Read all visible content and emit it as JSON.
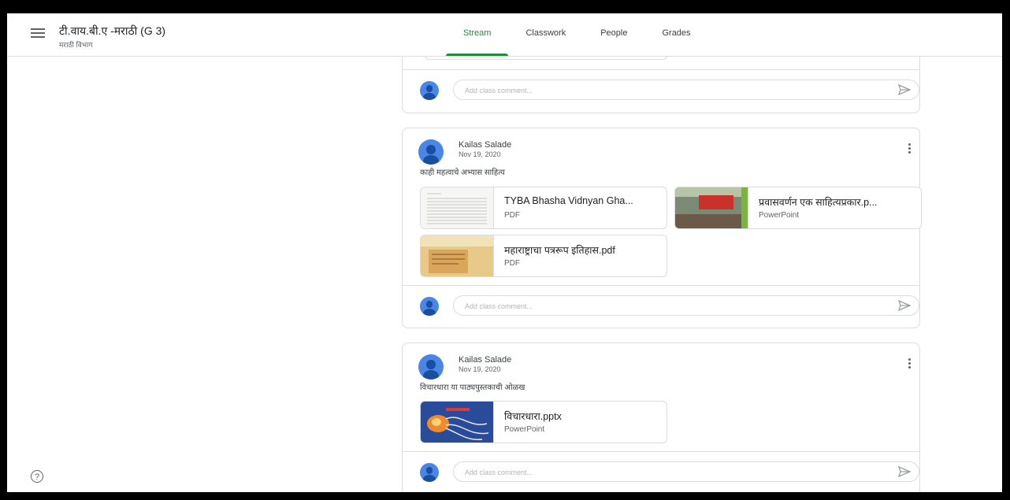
{
  "header": {
    "class_name": "टी.वाय.बी.ए -मराठी (G 3)",
    "section": "मराठी विभाग",
    "tabs": [
      "Stream",
      "Classwork",
      "People",
      "Grades"
    ],
    "active_tab": "Stream"
  },
  "comment_placeholder": "Add class comment...",
  "posts": [
    {
      "author": "Kailas Salade",
      "date": "Nov 19, 2020",
      "text": "काही महत्वाचे अभ्यास साहित्य",
      "attachments": [
        {
          "name": "TYBA Bhasha Vidnyan Gha...",
          "type": "PDF"
        },
        {
          "name": "प्रवासवर्णन एक साहित्यप्रकार.p...",
          "type": "PowerPoint"
        },
        {
          "name": "महाराष्ट्राचा पत्ररूप इतिहास.pdf",
          "type": "PDF"
        }
      ]
    },
    {
      "author": "Kailas Salade",
      "date": "Nov 19, 2020",
      "text": "विचारधारा या पाठ्यपुस्तकाची ओळख",
      "attachments": [
        {
          "name": "विचारधारा.pptx",
          "type": "PowerPoint"
        }
      ]
    }
  ],
  "colors": {
    "accent": "#1e8e3e",
    "avatar": "#4a86e8"
  },
  "icons": {
    "menu": "hamburger-menu-icon",
    "help": "help-icon",
    "send": "send-icon",
    "more": "more-vert-icon"
  },
  "help_glyph": "?"
}
